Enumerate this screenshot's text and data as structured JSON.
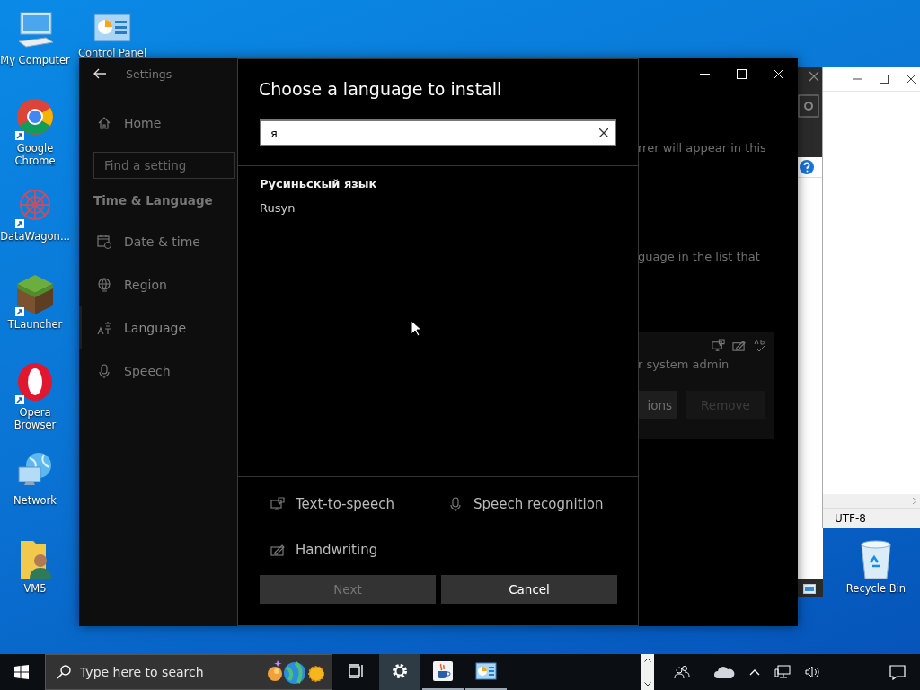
{
  "desktop_icons": [
    {
      "label": "My Computer",
      "kind": "computer",
      "shortcut": false
    },
    {
      "label": "Google Chrome",
      "kind": "chrome",
      "shortcut": true
    },
    {
      "label": "DataWagon...",
      "kind": "datawagon",
      "shortcut": true
    },
    {
      "label": "TLauncher",
      "kind": "tlauncher",
      "shortcut": true
    },
    {
      "label": "Opera Browser",
      "kind": "opera",
      "shortcut": true
    },
    {
      "label": "Network",
      "kind": "network",
      "shortcut": false
    },
    {
      "label": "VM5",
      "kind": "vm5",
      "shortcut": false
    }
  ],
  "desktop_icons_top": [
    {
      "label": "Control Panel",
      "kind": "control",
      "shortcut": false
    }
  ],
  "recycle_bin": {
    "label": "Recycle Bin"
  },
  "background_window": {
    "status": "UTF-8"
  },
  "settings": {
    "title": "Settings",
    "home": {
      "label": "Home"
    },
    "search": {
      "placeholder": "Find a setting"
    },
    "section": "Time & Language",
    "items": [
      {
        "label": "Date & time",
        "kind": "calendar",
        "selected": false
      },
      {
        "label": "Region",
        "kind": "globe",
        "selected": false
      },
      {
        "label": "Language",
        "kind": "language",
        "selected": true
      },
      {
        "label": "Speech",
        "kind": "mic",
        "selected": false
      }
    ],
    "content": {
      "line_1": "rrer will appear in this",
      "line_2": "guage in the list that",
      "card_text": "r system admin",
      "buttons": [
        {
          "label": "ions",
          "disabled": false
        },
        {
          "label": "Remove",
          "disabled": true
        }
      ]
    }
  },
  "dialog": {
    "title": "Choose a language to install",
    "search": {
      "value": "я"
    },
    "results": [
      {
        "native": "Русиньскый язык",
        "english": "Rusyn"
      }
    ],
    "features": [
      {
        "label": "Text-to-speech",
        "kind": "tts"
      },
      {
        "label": "Speech recognition",
        "kind": "mic"
      },
      {
        "label": "Handwriting",
        "kind": "pen"
      }
    ],
    "buttons": [
      {
        "label": "Next",
        "disabled": true
      },
      {
        "label": "Cancel",
        "disabled": false
      }
    ]
  },
  "taskbar": {
    "search": {
      "placeholder": "Type here to search"
    },
    "apps": [
      {
        "kind": "taskview",
        "selected": false,
        "running": false
      },
      {
        "kind": "settings",
        "selected": true,
        "running": false
      },
      {
        "kind": "java",
        "selected": false,
        "running": true
      },
      {
        "kind": "control",
        "selected": false,
        "running": true
      }
    ]
  }
}
